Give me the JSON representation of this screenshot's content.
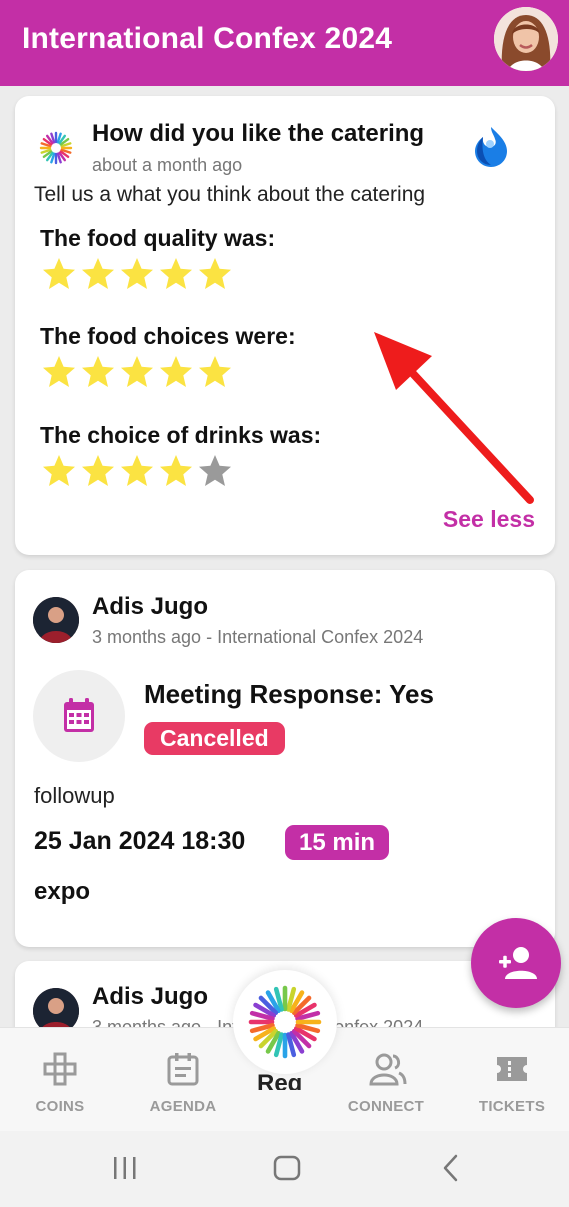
{
  "header": {
    "title": "International Confex 2024",
    "avatar_icon": "user-avatar"
  },
  "survey_card": {
    "title": "How did you like the catering",
    "time": "about a month ago",
    "description": "Tell us a what you think about the catering",
    "questions": [
      {
        "label": "The food quality was:",
        "rating": 5,
        "max": 5
      },
      {
        "label": "The food choices were:",
        "rating": 5,
        "max": 5
      },
      {
        "label": "The choice of drinks was:",
        "rating": 4,
        "max": 5
      }
    ],
    "toggle_label": "See less"
  },
  "meeting_card": {
    "author": "Adis Jugo",
    "meta": "3 months ago - International Confex 2024",
    "title": "Meeting Response: Yes",
    "status": "Cancelled",
    "note": "followup",
    "datetime": "25 Jan 2024 18:30",
    "duration": "15 min",
    "location": "expo"
  },
  "next_card": {
    "author": "Adis Jugo",
    "meta": "3 months ago - International Confex 2024"
  },
  "bottom_nav": {
    "items": [
      {
        "label": "COINS",
        "icon": "coins-icon"
      },
      {
        "label": "AGENDA",
        "icon": "agenda-icon"
      },
      {
        "label": "CONNECT",
        "icon": "connect-icon"
      },
      {
        "label": "TICKETS",
        "icon": "tickets-icon"
      }
    ],
    "center_peek": "Reg"
  },
  "colors": {
    "brand": "#c32fa6",
    "cancelled": "#e83a64",
    "star_on": "#fbe342",
    "star_off": "#9a9a9a",
    "annotation": "#ee1c1c"
  }
}
